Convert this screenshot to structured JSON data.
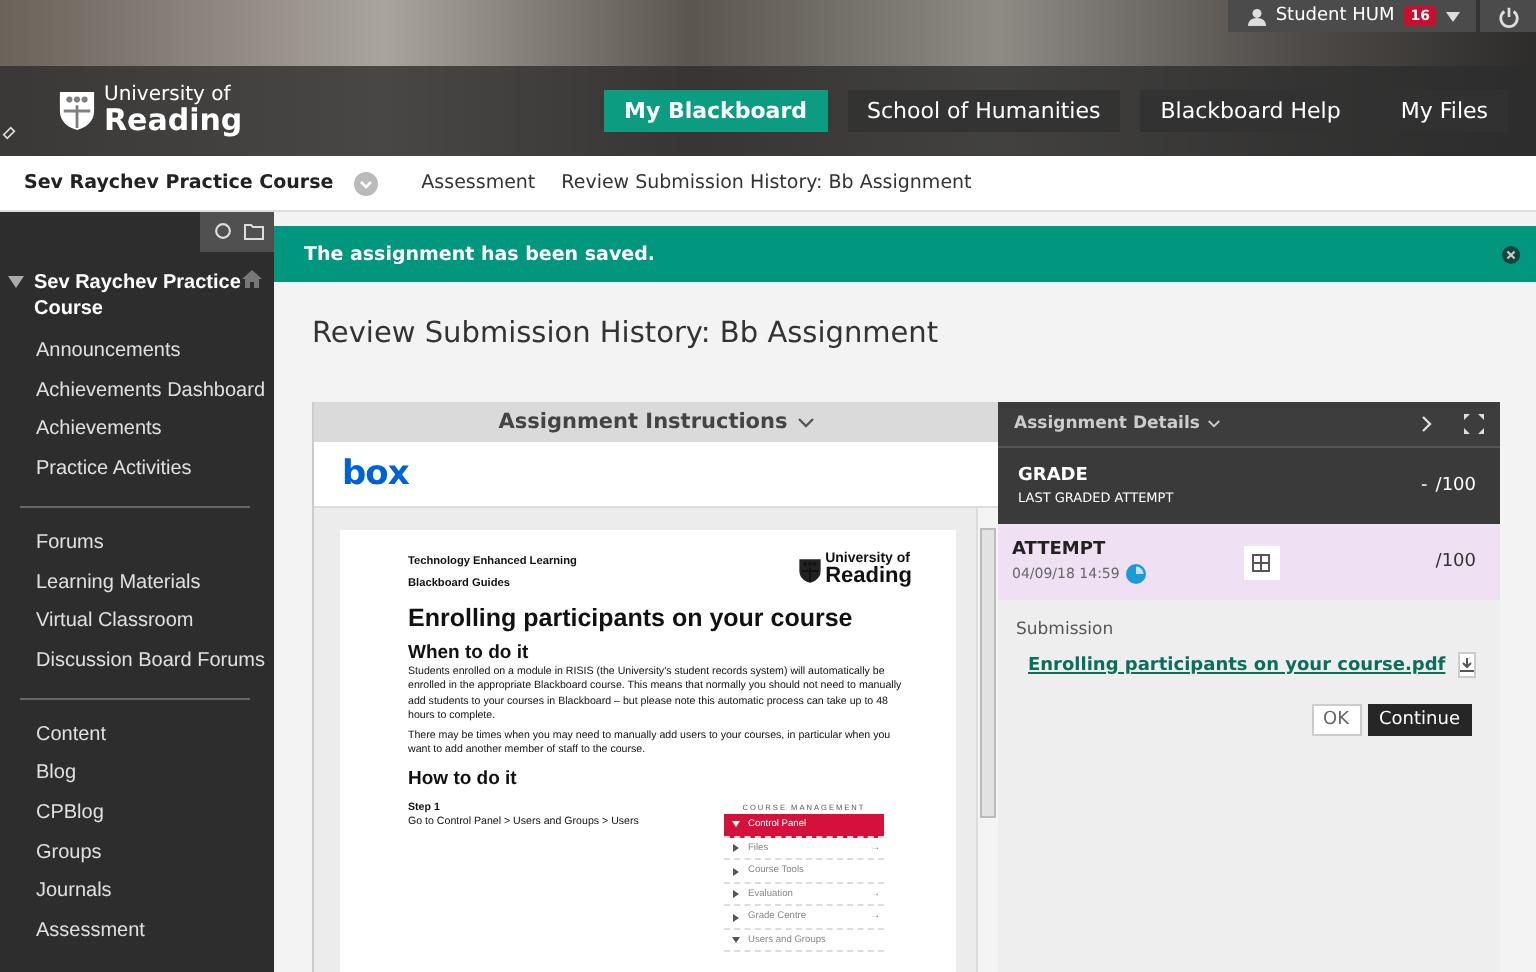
{
  "header": {
    "user_menu": {
      "name": "Student HUM",
      "badge": "16"
    },
    "logo": {
      "line1": "University of",
      "line2": "Reading"
    },
    "tabs": [
      {
        "label": "My Blackboard",
        "selected": true
      },
      {
        "label": "School of Humanities",
        "selected": false
      },
      {
        "label": "Blackboard Help",
        "selected": false
      },
      {
        "label": "My Files",
        "selected": false
      }
    ]
  },
  "breadcrumbs": {
    "course": "Sev Raychev Practice Course",
    "items": [
      "Assessment",
      "Review Submission History: Bb Assignment"
    ]
  },
  "sidebar": {
    "course_title": "Sev Raychev Practice Course",
    "expanded": true,
    "groups": [
      [
        "Announcements",
        "Achievements Dashboard",
        "Achievements",
        "Practice Activities"
      ],
      [
        "Forums",
        "Learning Materials",
        "Virtual Classroom",
        "Discussion Board Forums"
      ],
      [
        "Content",
        "Blog",
        "CPBlog",
        "Groups",
        "Journals",
        "Assessment"
      ]
    ]
  },
  "banner": {
    "message": "The assignment has been saved."
  },
  "page_title": "Review Submission History: Bb Assignment",
  "instructions": {
    "header": "Assignment Instructions",
    "provider": "box",
    "document": {
      "kicker": "Technology Enhanced Learning",
      "series": "Blackboard Guides",
      "logo": {
        "line1": "University of",
        "line2": "Reading"
      },
      "title": "Enrolling participants on your course",
      "sections": [
        {
          "heading": "When to do it",
          "paragraphs": [
            "Students enrolled on a module in RISIS (the University's student records system) will automatically be enrolled in the appropriate Blackboard course. This means that normally you should not need to manually add students to your courses in Blackboard – but please note this automatic process can take up to 48 hours to complete.",
            "There may be times when you may need to manually add users to your courses, in particular when you want to add another member of staff to the course."
          ]
        },
        {
          "heading": "How to do it"
        }
      ],
      "step": {
        "title": "Step 1",
        "text": "Go to Control Panel > Users and Groups > Users"
      },
      "menu": {
        "title": "COURSE MANAGEMENT",
        "items": [
          {
            "label": "Control Panel",
            "selected": true,
            "expanded": true
          },
          {
            "label": "Files",
            "selected": false,
            "expanded": false,
            "arrow": "→"
          },
          {
            "label": "Course Tools",
            "selected": false,
            "expanded": false
          },
          {
            "label": "Evaluation",
            "selected": false,
            "expanded": false,
            "arrow": "→"
          },
          {
            "label": "Grade Centre",
            "selected": false,
            "expanded": false,
            "arrow": "→"
          },
          {
            "label": "Users and Groups",
            "selected": false,
            "expanded": true
          }
        ]
      }
    }
  },
  "details": {
    "header": "Assignment Details",
    "grade": {
      "title": "GRADE",
      "subtitle": "LAST GRADED ATTEMPT",
      "score": "-",
      "out_of": "/100"
    },
    "attempt": {
      "title": "ATTEMPT",
      "date": "04/09/18 14:59",
      "out_of": "/100"
    },
    "submission": {
      "label": "Submission",
      "file": "Enrolling participants on your course.pdf"
    },
    "buttons": [
      {
        "label": "OK",
        "kind": "secondary"
      },
      {
        "label": "Continue",
        "kind": "primary"
      }
    ]
  }
}
